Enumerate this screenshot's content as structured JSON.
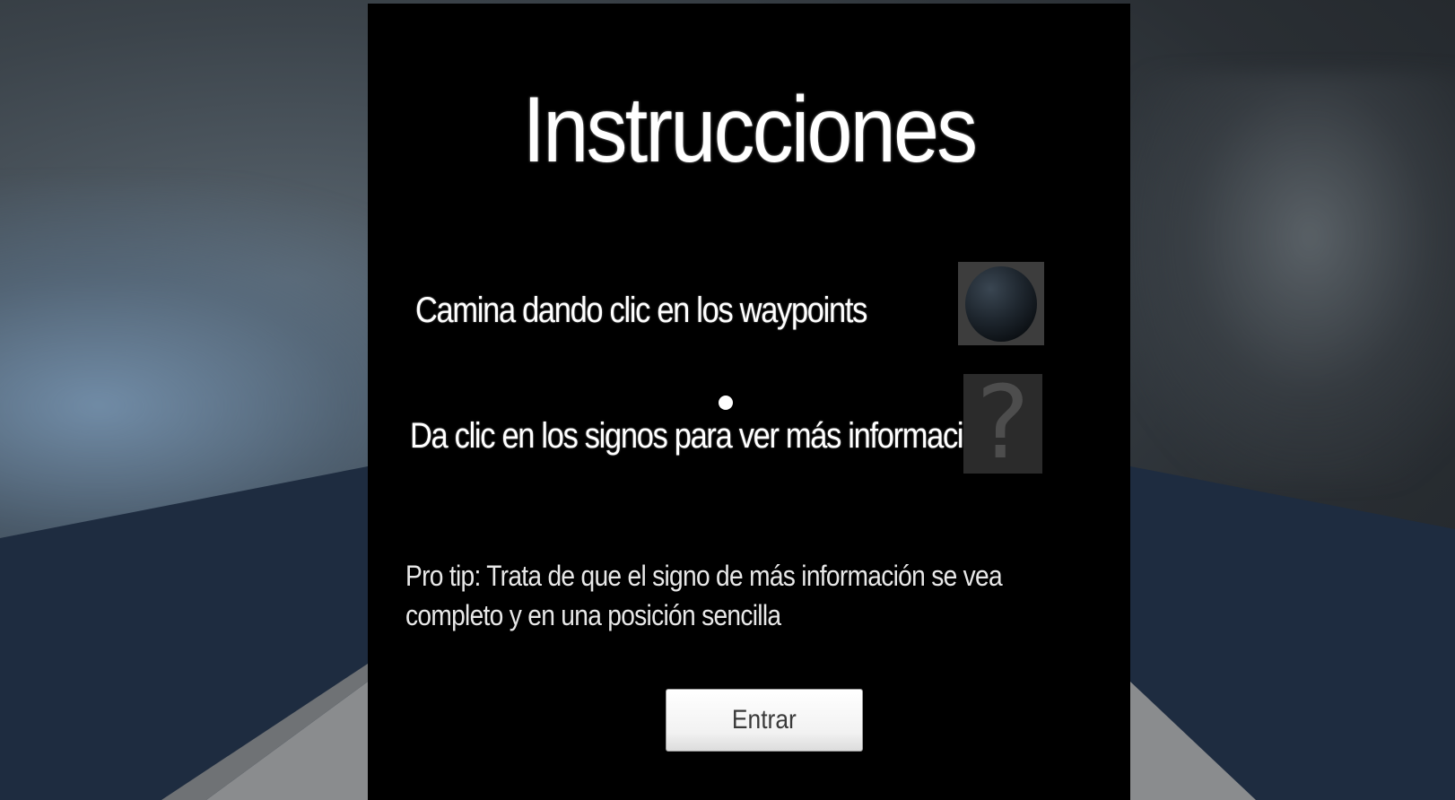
{
  "dialog": {
    "title": "Instrucciones",
    "instructions": [
      {
        "text": "Camina dando clic en los waypoints",
        "icon": "waypoint-sphere-icon"
      },
      {
        "text": "Da clic en los signos para ver más información",
        "icon": "question-mark-icon",
        "glyph": "?"
      }
    ],
    "pro_tip": "Pro tip: Trata de que el signo de más información se vea completo y en una posición sencilla",
    "enter_label": "Entrar"
  },
  "colors": {
    "panel": "#000000",
    "text": "#ffffff",
    "button": "#f2f2f2",
    "floor": "#1e2c40",
    "walkway": "#8a8c8e"
  }
}
